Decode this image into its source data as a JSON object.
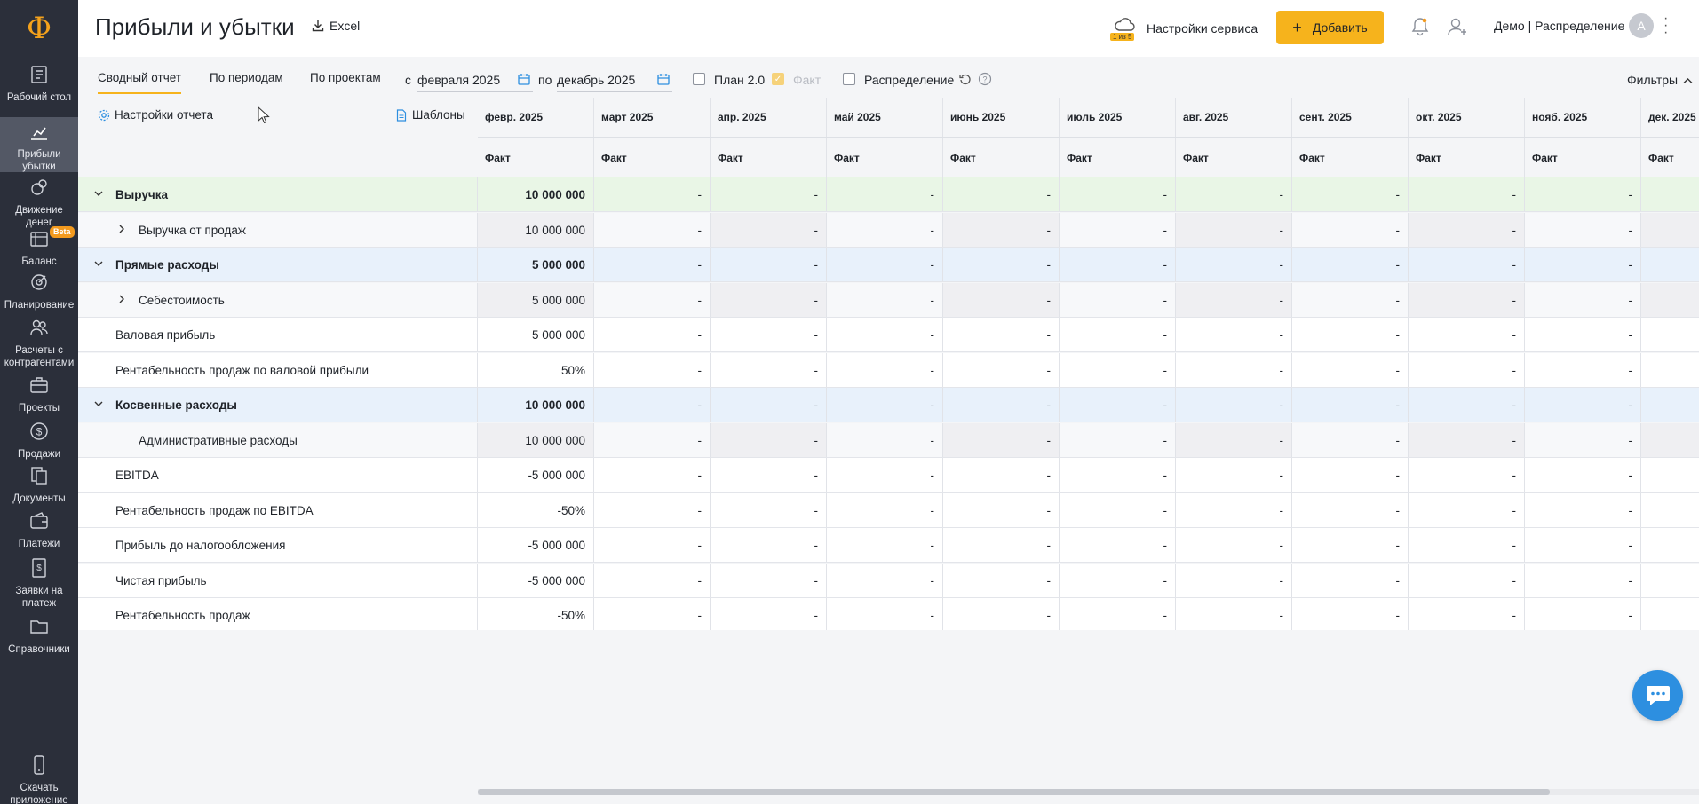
{
  "brand": {
    "logo_glyph": "Ф",
    "accent": "#f6b31c"
  },
  "sidebar": {
    "items": [
      {
        "label": "Рабочий стол",
        "icon": "desk-icon"
      },
      {
        "label": "Прибыли убытки",
        "icon": "chart-icon",
        "active": true
      },
      {
        "label": "Движение денег",
        "icon": "money-flow-icon"
      },
      {
        "label": "Баланс",
        "icon": "balance-icon",
        "badge": "Beta"
      },
      {
        "label": "Планирование",
        "icon": "target-icon"
      },
      {
        "label": "Расчеты с контрагентами",
        "icon": "people-icon"
      },
      {
        "label": "Проекты",
        "icon": "briefcase-icon"
      },
      {
        "label": "Продажи",
        "icon": "dollar-icon"
      },
      {
        "label": "Документы",
        "icon": "documents-icon"
      },
      {
        "label": "Платежи",
        "icon": "wallet-icon"
      },
      {
        "label": "Заявки на платеж",
        "icon": "invoice-icon"
      },
      {
        "label": "Справочники",
        "icon": "folder-icon"
      },
      {
        "label": "Скачать приложение",
        "icon": "phone-icon"
      }
    ]
  },
  "header": {
    "title": "Прибыли и убытки",
    "excel_label": "Excel",
    "service_label": "Настройки сервиса",
    "service_badge": "1 из 5",
    "add_label": "Добавить",
    "user_name": "Демо | Распределение",
    "avatar_letter": "A"
  },
  "toolbar": {
    "tabs": [
      "Сводный отчет",
      "По периодам",
      "По проектам"
    ],
    "from_label": "с",
    "from_value": "февраля 2025",
    "to_label": "по",
    "to_value": "декабрь 2025",
    "plan_label": "План 2.0",
    "fact_label": "Факт",
    "distribution_label": "Распределение",
    "filters_label": "Фильтры"
  },
  "table": {
    "report_settings_label": "Настройки отчета",
    "templates_label": "Шаблоны",
    "months": [
      "февр. 2025",
      "март 2025",
      "апр. 2025",
      "май 2025",
      "июнь 2025",
      "июль 2025",
      "авг. 2025",
      "сент. 2025",
      "окт. 2025",
      "нояб. 2025",
      "дек. 2025"
    ],
    "subheader": "Факт",
    "rows": [
      {
        "label": "Выручка",
        "kind": "group-green",
        "chevron": "down",
        "indent": 0,
        "bold": true,
        "values": [
          "10 000 000",
          "-",
          "-",
          "-",
          "-",
          "-",
          "-",
          "-",
          "-",
          "-",
          ""
        ]
      },
      {
        "label": "Выручка от продаж",
        "kind": "sub",
        "chevron": "right",
        "indent": 1,
        "bold": false,
        "values": [
          "10 000 000",
          "-",
          "-",
          "-",
          "-",
          "-",
          "-",
          "-",
          "-",
          "-",
          ""
        ]
      },
      {
        "label": "Прямые расходы",
        "kind": "group-blue",
        "chevron": "down",
        "indent": 0,
        "bold": true,
        "values": [
          "5 000 000",
          "-",
          "-",
          "-",
          "-",
          "-",
          "-",
          "-",
          "-",
          "-",
          ""
        ]
      },
      {
        "label": "Себестоимость",
        "kind": "sub",
        "chevron": "right",
        "indent": 1,
        "bold": false,
        "values": [
          "5 000 000",
          "-",
          "-",
          "-",
          "-",
          "-",
          "-",
          "-",
          "-",
          "-",
          ""
        ]
      },
      {
        "label": "Валовая прибыль",
        "kind": "plain",
        "chevron": "",
        "indent": 0,
        "bold": false,
        "values": [
          "5 000 000",
          "-",
          "-",
          "-",
          "-",
          "-",
          "-",
          "-",
          "-",
          "-",
          ""
        ]
      },
      {
        "label": "Рентабельность продаж по валовой прибыли",
        "kind": "plain",
        "chevron": "",
        "indent": 0,
        "bold": false,
        "values": [
          "50%",
          "-",
          "-",
          "-",
          "-",
          "-",
          "-",
          "-",
          "-",
          "-",
          ""
        ]
      },
      {
        "label": "Косвенные расходы",
        "kind": "group-blue",
        "chevron": "down",
        "indent": 0,
        "bold": true,
        "values": [
          "10 000 000",
          "-",
          "-",
          "-",
          "-",
          "-",
          "-",
          "-",
          "-",
          "-",
          ""
        ]
      },
      {
        "label": "Административные расходы",
        "kind": "sub",
        "chevron": "",
        "indent": 1,
        "bold": false,
        "values": [
          "10 000 000",
          "-",
          "-",
          "-",
          "-",
          "-",
          "-",
          "-",
          "-",
          "-",
          ""
        ]
      },
      {
        "label": "EBITDA",
        "kind": "plain",
        "chevron": "",
        "indent": 0,
        "bold": false,
        "values": [
          "-5 000 000",
          "-",
          "-",
          "-",
          "-",
          "-",
          "-",
          "-",
          "-",
          "-",
          ""
        ]
      },
      {
        "label": "Рентабельность продаж по EBITDA",
        "kind": "plain",
        "chevron": "",
        "indent": 0,
        "bold": false,
        "values": [
          "-50%",
          "-",
          "-",
          "-",
          "-",
          "-",
          "-",
          "-",
          "-",
          "-",
          ""
        ]
      },
      {
        "label": "Прибыль до налогообложения",
        "kind": "plain",
        "chevron": "",
        "indent": 0,
        "bold": false,
        "values": [
          "-5 000 000",
          "-",
          "-",
          "-",
          "-",
          "-",
          "-",
          "-",
          "-",
          "-",
          ""
        ]
      },
      {
        "label": "Чистая прибыль",
        "kind": "plain",
        "chevron": "",
        "indent": 0,
        "bold": false,
        "values": [
          "-5 000 000",
          "-",
          "-",
          "-",
          "-",
          "-",
          "-",
          "-",
          "-",
          "-",
          ""
        ]
      },
      {
        "label": "Рентабельность продаж",
        "kind": "plain",
        "chevron": "",
        "indent": 0,
        "bold": false,
        "values": [
          "-50%",
          "-",
          "-",
          "-",
          "-",
          "-",
          "-",
          "-",
          "-",
          "-",
          ""
        ]
      }
    ]
  }
}
